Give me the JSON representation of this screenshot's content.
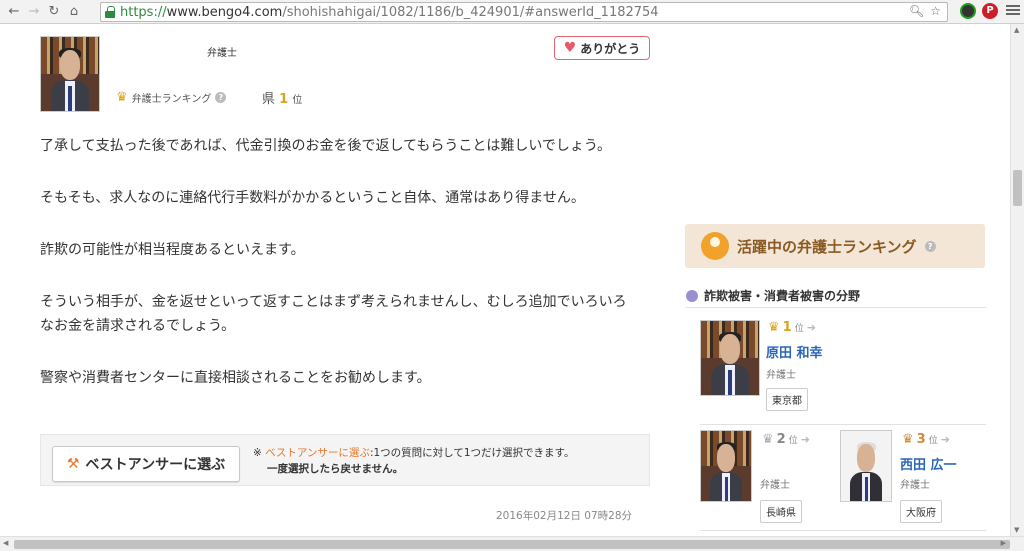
{
  "browser": {
    "url_https": "https://",
    "url_domain": "www.bengo4.com",
    "url_path": "/shohishahigai/1082/1186/b_424901/#answerId_1182754"
  },
  "answerer": {
    "role": "弁護士",
    "thanks_label": "ありがとう",
    "ranking_label": "弁護士ランキング",
    "pref_prefix": "県",
    "pref_rank": "1",
    "pref_unit": "位"
  },
  "answer": {
    "paragraphs": [
      "了承して支払った後であれば、代金引換のお金を後で返してもらうことは難しいでしょう。",
      "そもそも、求人なのに連絡代行手数料がかかるということ自体、通常はあり得ません。",
      "詐欺の可能性が相当程度あるといえます。",
      "そういう相手が、金を返せといって返すことはまず考えられませんし、むしろ追加でいろいろなお金を請求されるでしょう。",
      "警察や消費者センターに直接相談されることをお勧めします。"
    ]
  },
  "best_answer": {
    "button_label": "ベストアンサーに選ぶ",
    "note_prefix": "※ ",
    "note_link": "ベストアンサーに選ぶ",
    "note_rest": ":1つの質問に対して1つだけ選択できます。",
    "note_bold": "一度選択したら戻せません。"
  },
  "date": "2016年02月12日 07時28分",
  "sidebar": {
    "ranking_title": "活躍中の弁護士ランキング",
    "field_title": "詐欺被害・消費者被害の分野",
    "lawyers": [
      {
        "rank": "1",
        "rank_unit": "位",
        "name": "原田 和幸",
        "role": "弁護士",
        "location": "東京都"
      },
      {
        "rank": "2",
        "rank_unit": "位",
        "name": "",
        "role": "弁護士",
        "location": "長崎県"
      },
      {
        "rank": "3",
        "rank_unit": "位",
        "name": "西田 広一",
        "role": "弁護士",
        "location": "大阪府"
      }
    ]
  },
  "colors": {
    "accent_orange": "#e5772b",
    "gold": "#d9a21c",
    "link_blue": "#2a66b5",
    "banner_bg": "#f3e6d6"
  }
}
